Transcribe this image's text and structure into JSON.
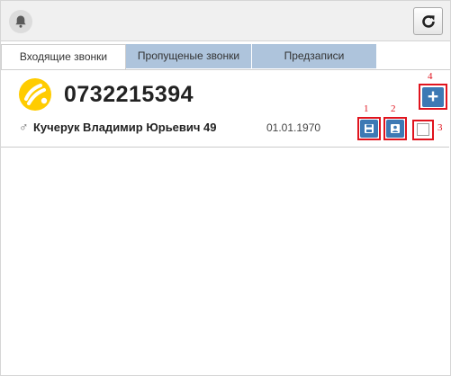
{
  "toolbar": {
    "bell_icon": "bell-icon",
    "refresh_icon": "refresh-icon"
  },
  "tabs": [
    {
      "label": "Входящие звонки",
      "active": true
    },
    {
      "label": "Пропущеные звонки",
      "active": false
    },
    {
      "label": "Предзаписи",
      "active": false
    }
  ],
  "call": {
    "phone": "0732215394",
    "operator_logo": "lifecell-logo",
    "gender_icon": "male-icon",
    "name": "Кучерук Владимир Юрьевич 49",
    "birth_date": "01.01.1970"
  },
  "actions": {
    "add_label": "+",
    "markers": [
      "1",
      "2",
      "3",
      "4"
    ]
  },
  "colors": {
    "accent": "#3d79b4",
    "tab_inactive": "#aec4dc",
    "highlight": "#e0141e",
    "logo": "#ffcc00"
  }
}
